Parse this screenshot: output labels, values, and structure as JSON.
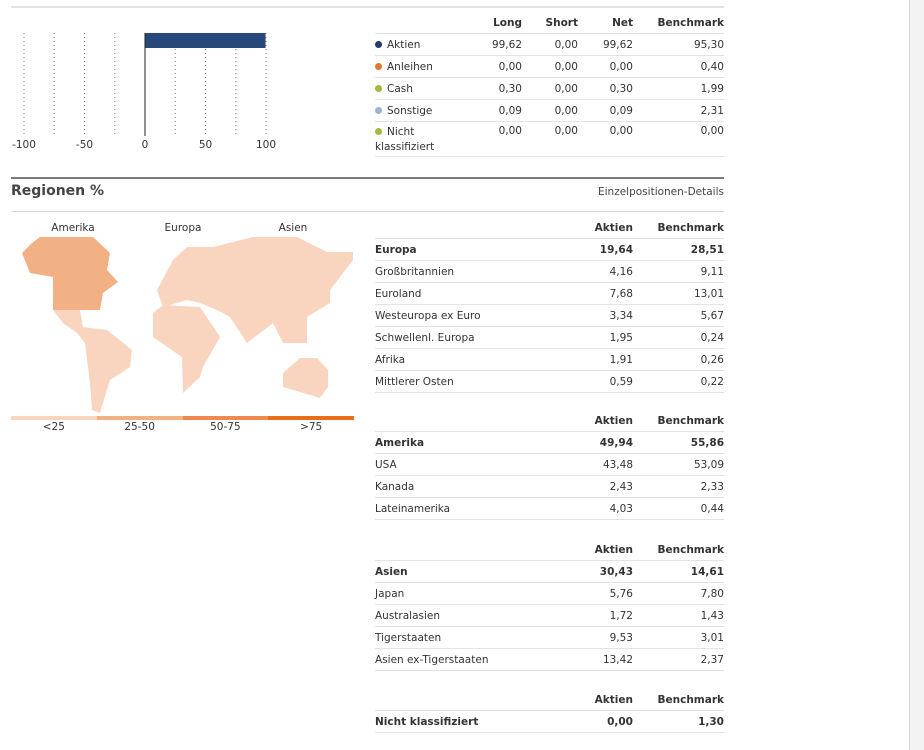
{
  "asset_chart": {
    "type": "bar",
    "orientation": "horizontal",
    "categories": [
      "Aktien"
    ],
    "values": [
      99.62
    ],
    "xlim": [
      -100,
      100
    ],
    "x_ticks": [
      "-100",
      "-50",
      "0",
      "50",
      "100"
    ],
    "grid": "dotted every 25",
    "bar_color": "#28477a"
  },
  "asset_table": {
    "headers": [
      "Long",
      "Short",
      "Net",
      "Benchmark"
    ],
    "rows": [
      {
        "label": "Aktien",
        "color": "#1f3a6e",
        "long": "99,62",
        "short": "0,00",
        "net": "99,62",
        "benchmark": "95,30"
      },
      {
        "label": "Anleihen",
        "color": "#e8762d",
        "long": "0,00",
        "short": "0,00",
        "net": "0,00",
        "benchmark": "0,40"
      },
      {
        "label": "Cash",
        "color": "#a4b93a",
        "long": "0,30",
        "short": "0,00",
        "net": "0,30",
        "benchmark": "1,99"
      },
      {
        "label": "Sonstige",
        "color": "#9ab3d5",
        "long": "0,09",
        "short": "0,00",
        "net": "0,09",
        "benchmark": "2,31"
      },
      {
        "label": "Nicht klassifiziert",
        "color": "#a4b93a",
        "long": "0,00",
        "short": "0,00",
        "net": "0,00",
        "benchmark": "0,00"
      }
    ]
  },
  "regions": {
    "title": "Regionen %",
    "details_link": "Einzelpositionen-Details",
    "map_labels": [
      "Amerika",
      "Europa",
      "Asien"
    ],
    "legend": [
      {
        "label": "<25",
        "color": "#f9d5c0"
      },
      {
        "label": "25-50",
        "color": "#f2b085"
      },
      {
        "label": "50-75",
        "color": "#ee8a4e"
      },
      {
        "label": ">75",
        "color": "#e86e18"
      }
    ],
    "tables": [
      {
        "headers": [
          "Aktien",
          "Benchmark"
        ],
        "total": {
          "label": "Europa",
          "aktien": "19,64",
          "benchmark": "28,51"
        },
        "rows": [
          {
            "label": "Großbritannien",
            "aktien": "4,16",
            "benchmark": "9,11"
          },
          {
            "label": "Euroland",
            "aktien": "7,68",
            "benchmark": "13,01"
          },
          {
            "label": "Westeuropa ex Euro",
            "aktien": "3,34",
            "benchmark": "5,67"
          },
          {
            "label": "Schwellenl. Europa",
            "aktien": "1,95",
            "benchmark": "0,24"
          },
          {
            "label": "Afrika",
            "aktien": "1,91",
            "benchmark": "0,26"
          },
          {
            "label": "Mittlerer Osten",
            "aktien": "0,59",
            "benchmark": "0,22"
          }
        ]
      },
      {
        "headers": [
          "Aktien",
          "Benchmark"
        ],
        "total": {
          "label": "Amerika",
          "aktien": "49,94",
          "benchmark": "55,86"
        },
        "rows": [
          {
            "label": "USA",
            "aktien": "43,48",
            "benchmark": "53,09"
          },
          {
            "label": "Kanada",
            "aktien": "2,43",
            "benchmark": "2,33"
          },
          {
            "label": "Lateinamerika",
            "aktien": "4,03",
            "benchmark": "0,44"
          }
        ]
      },
      {
        "headers": [
          "Aktien",
          "Benchmark"
        ],
        "total": {
          "label": "Asien",
          "aktien": "30,43",
          "benchmark": "14,61"
        },
        "rows": [
          {
            "label": "Japan",
            "aktien": "5,76",
            "benchmark": "7,80"
          },
          {
            "label": "Australasien",
            "aktien": "1,72",
            "benchmark": "1,43"
          },
          {
            "label": "Tigerstaaten",
            "aktien": "9,53",
            "benchmark": "3,01"
          },
          {
            "label": "Asien ex-Tigerstaaten",
            "aktien": "13,42",
            "benchmark": "2,37"
          }
        ]
      },
      {
        "headers": [
          "Aktien",
          "Benchmark"
        ],
        "total": {
          "label": "Nicht klassifiziert",
          "aktien": "0,00",
          "benchmark": "1,30"
        },
        "rows": []
      }
    ]
  }
}
